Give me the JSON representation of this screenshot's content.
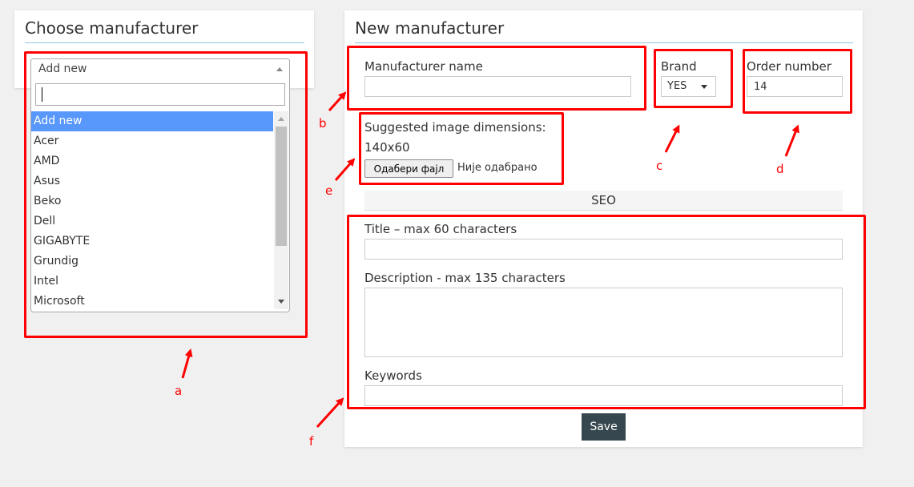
{
  "left_panel": {
    "title": "Choose manufacturer",
    "select_value": "Add new",
    "search_value": "",
    "options": [
      "Add new",
      "Acer",
      "AMD",
      "Asus",
      "Beko",
      "Dell",
      "GIGABYTE",
      "Grundig",
      "Intel",
      "Microsoft"
    ],
    "selected_option": "Add new"
  },
  "right_panel": {
    "title": "New manufacturer",
    "name_label": "Manufacturer name",
    "name_value": "",
    "brand_label": "Brand",
    "brand_value": "YES",
    "order_label": "Order number",
    "order_value": "14",
    "image_label": "Suggested image dimensions:",
    "image_dims": "140x60",
    "file_button_label": "Одабери фајл",
    "file_status": "Није одабрано",
    "seo_label": "SEO",
    "seo_title_label": "Title – max 60 characters",
    "seo_title_value": "",
    "seo_desc_label": "Description - max 135 characters",
    "seo_desc_value": "",
    "keywords_label": "Keywords",
    "keywords_value": "",
    "save_label": "Save"
  },
  "annotations": {
    "letters": [
      "a",
      "b",
      "c",
      "d",
      "e",
      "f"
    ],
    "color": "#ff0000"
  },
  "colors": {
    "highlight": "#5897fb",
    "save_button": "#37474f",
    "title_rule": "#8ec5de"
  }
}
